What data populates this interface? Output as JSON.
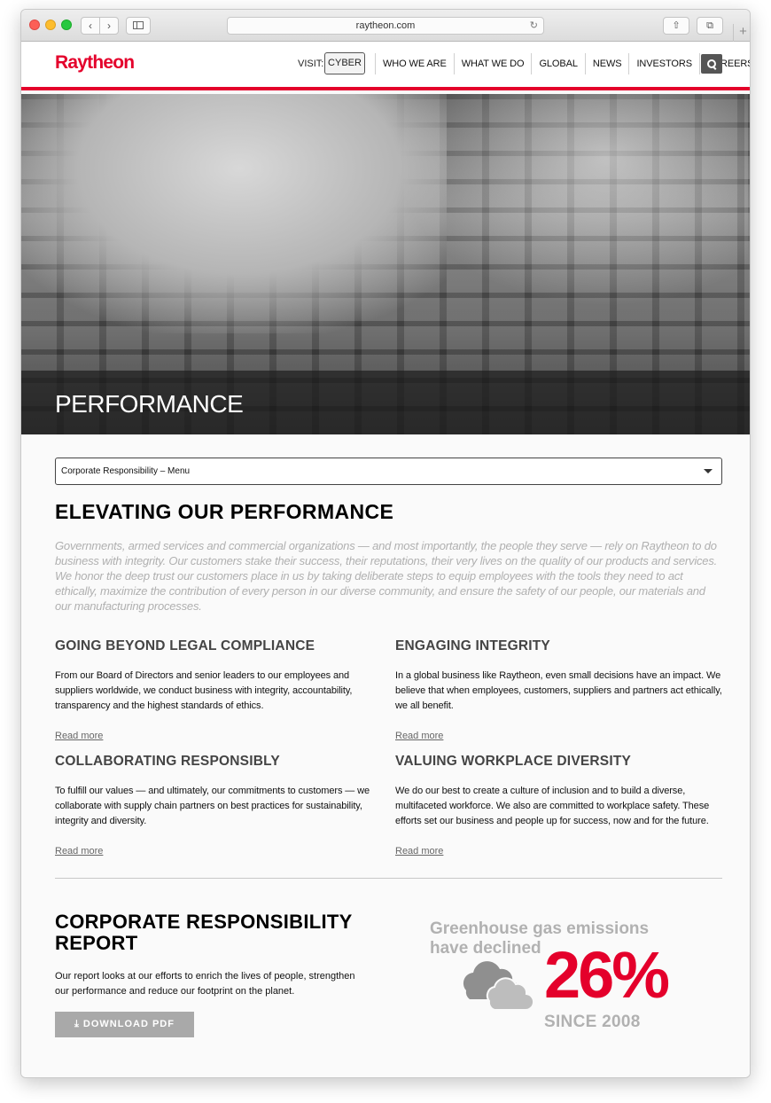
{
  "browser": {
    "url": "raytheon.com",
    "new_tab_symbol": "+"
  },
  "header": {
    "logo_text": "Raytheon",
    "visit_label": "VISIT:",
    "cyber_label": "CYBER",
    "nav": [
      "WHO WE ARE",
      "WHAT WE DO",
      "GLOBAL",
      "NEWS",
      "INVESTORS",
      "CAREERS"
    ]
  },
  "hero": {
    "title": "PERFORMANCE"
  },
  "menu": {
    "label": "Corporate Responsibility – Menu"
  },
  "main": {
    "title": "ELEVATING OUR PERFORMANCE",
    "intro": "Governments, armed services and commercial organizations — and most importantly, the people they serve — rely on Raytheon to do business with integrity. Our customers stake their success, their reputations, their very lives on the quality of our products and services. We honor the deep trust our customers place in us by taking deliberate steps to equip employees with the tools they need to act ethically, maximize the contribution of every person in our diverse community, and ensure the safety of our people, our materials and our manufacturing processes.",
    "pillars": [
      {
        "title": "GOING BEYOND LEGAL COMPLIANCE",
        "text": "From our Board of Directors and senior leaders to our employees and suppliers worldwide, we conduct business with integrity, accountability, transparency and the highest standards of ethics.",
        "link": "Read more"
      },
      {
        "title": "ENGAGING INTEGRITY",
        "text": "In a global business like Raytheon, even small decisions have an impact. We believe that when employees, customers, suppliers and partners act ethically, we all benefit.",
        "link": "Read more"
      },
      {
        "title": "COLLABORATING RESPONSIBLY",
        "text": "To fulfill our values — and ultimately, our commitments to customers — we collaborate with supply chain partners on best practices for sustainability, integrity and diversity.",
        "link": "Read more"
      },
      {
        "title": "VALUING WORKPLACE DIVERSITY",
        "text": "We do our best to create a culture of inclusion and to build a diverse, multifaceted workforce. We also are committed to workplace safety. These efforts set our business and people up for success, now and for the future.",
        "link": "Read more"
      }
    ]
  },
  "report": {
    "title": "CORPORATE RESPONSIBILITY REPORT",
    "text": "Our report looks at our efforts to enrich the lives of people, strengthen our performance and reduce our footprint on the planet.",
    "download_label": "DOWNLOAD PDF"
  },
  "stat": {
    "headline": "Greenhouse gas emissions have declined",
    "value": "26%",
    "since": "SINCE 2008"
  },
  "colors": {
    "brand_red": "#e4002b",
    "stat_gray": "#b1b1b1"
  },
  "icons": [
    "search-icon",
    "caret-down-icon",
    "download-icon",
    "cloud-icon",
    "reload-icon",
    "share-icon",
    "tabs-icon",
    "sidebar-icon"
  ]
}
